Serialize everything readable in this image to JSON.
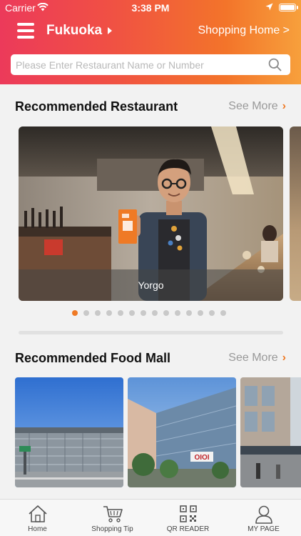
{
  "status_bar": {
    "carrier": "Carrier",
    "time": "3:38 PM"
  },
  "header": {
    "city": "Fukuoka",
    "shopping_home": "Shopping Home >",
    "search_placeholder": "Please Enter Restaurant Name or Number"
  },
  "restaurants": {
    "title": "Recommended Restaurant",
    "see_more": "See More",
    "slide_caption": "Yorgo",
    "dot_count": 14,
    "active_dot": 0
  },
  "food_mall": {
    "title": "Recommended Food Mall",
    "see_more": "See More",
    "sign_text": "OIOI"
  },
  "tabbar": {
    "items": [
      {
        "label": "Home",
        "icon": "home-icon"
      },
      {
        "label": "Shopping Tip",
        "icon": "cart-icon"
      },
      {
        "label": "QR READER",
        "icon": "qr-icon"
      },
      {
        "label": "MY PAGE",
        "icon": "user-icon"
      }
    ]
  },
  "colors": {
    "accent": "#ef7a25",
    "header_start": "#ec3a5a",
    "header_end": "#f7a03c"
  }
}
